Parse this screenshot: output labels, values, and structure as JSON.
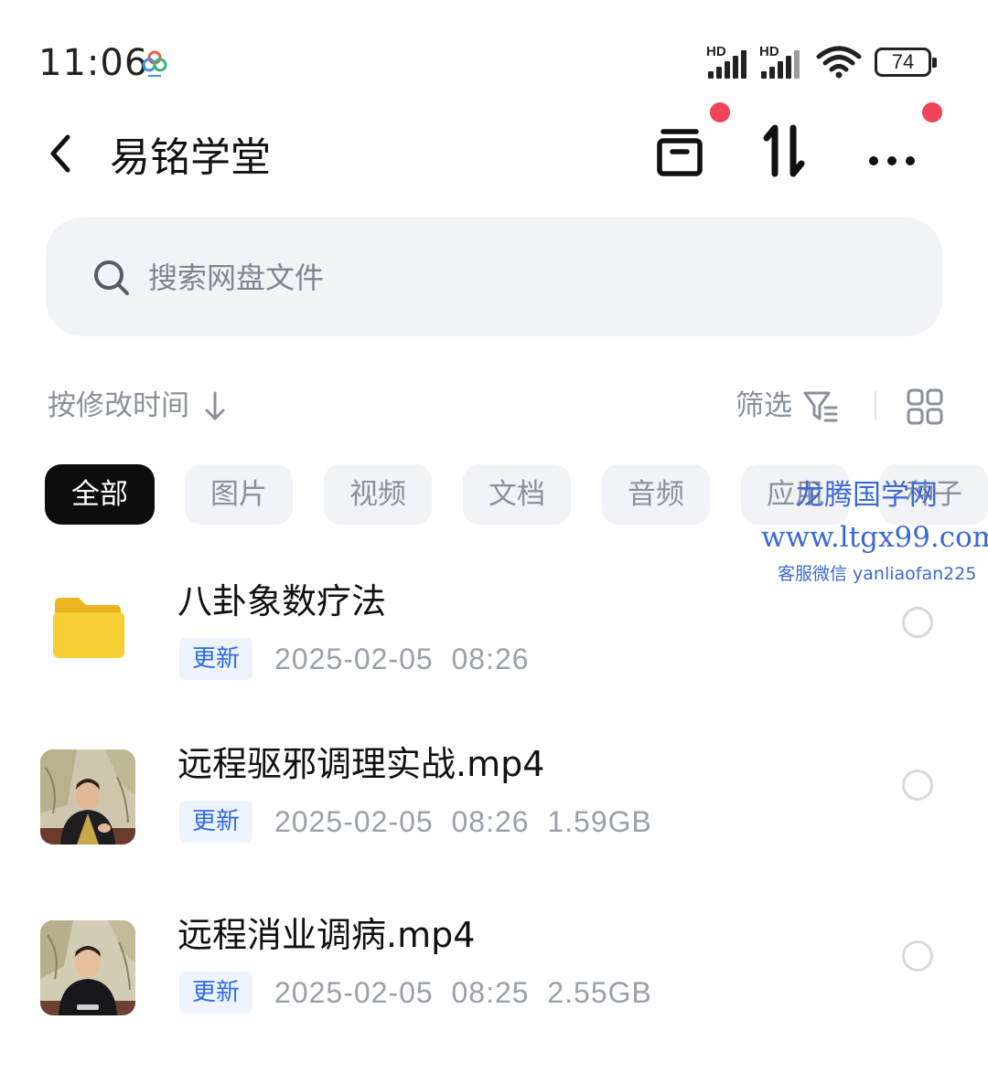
{
  "status_bar": {
    "time": "11:06",
    "signal_1_label": "HD",
    "signal_2_label": "HD",
    "battery": "74",
    "icons": [
      "app-cluster-icon",
      "signal-icon",
      "wifi-icon",
      "battery-icon"
    ]
  },
  "header": {
    "back_icon": "chevron-left-icon",
    "title": "易铭学堂",
    "actions": [
      "archive-icon",
      "transfer-icon",
      "more-icon"
    ]
  },
  "search": {
    "placeholder": "搜索网盘文件"
  },
  "toolbar": {
    "sort_label": "按修改时间",
    "filter_label": "筛选",
    "view_icon": "grid-view-icon"
  },
  "chips": [
    {
      "label": "全部",
      "active": true
    },
    {
      "label": "图片",
      "active": false
    },
    {
      "label": "视频",
      "active": false
    },
    {
      "label": "文档",
      "active": false
    },
    {
      "label": "音频",
      "active": false
    },
    {
      "label": "应用",
      "active": false
    },
    {
      "label": "种子",
      "active": false
    }
  ],
  "watermark": {
    "title": "龙腾国学网",
    "url": "www.ltgx99.com",
    "contact": "客服微信 yanliaofan225"
  },
  "files": [
    {
      "name": "八卦象数疗法",
      "type": "folder",
      "badge": "更新",
      "date": "2025-02-05",
      "time": "08:26",
      "size": ""
    },
    {
      "name": "远程驱邪调理实战.mp4",
      "type": "video",
      "badge": "更新",
      "date": "2025-02-05",
      "time": "08:26",
      "size": "1.59GB"
    },
    {
      "name": "远程消业调病.mp4",
      "type": "video",
      "badge": "更新",
      "date": "2025-02-05",
      "time": "08:25",
      "size": "2.55GB"
    }
  ],
  "colors": {
    "accent_blue": "#2d6ae8",
    "badge_red": "#f0445a",
    "chip_active": "#0d0d0d",
    "folder_yellow": "#f7c530"
  }
}
